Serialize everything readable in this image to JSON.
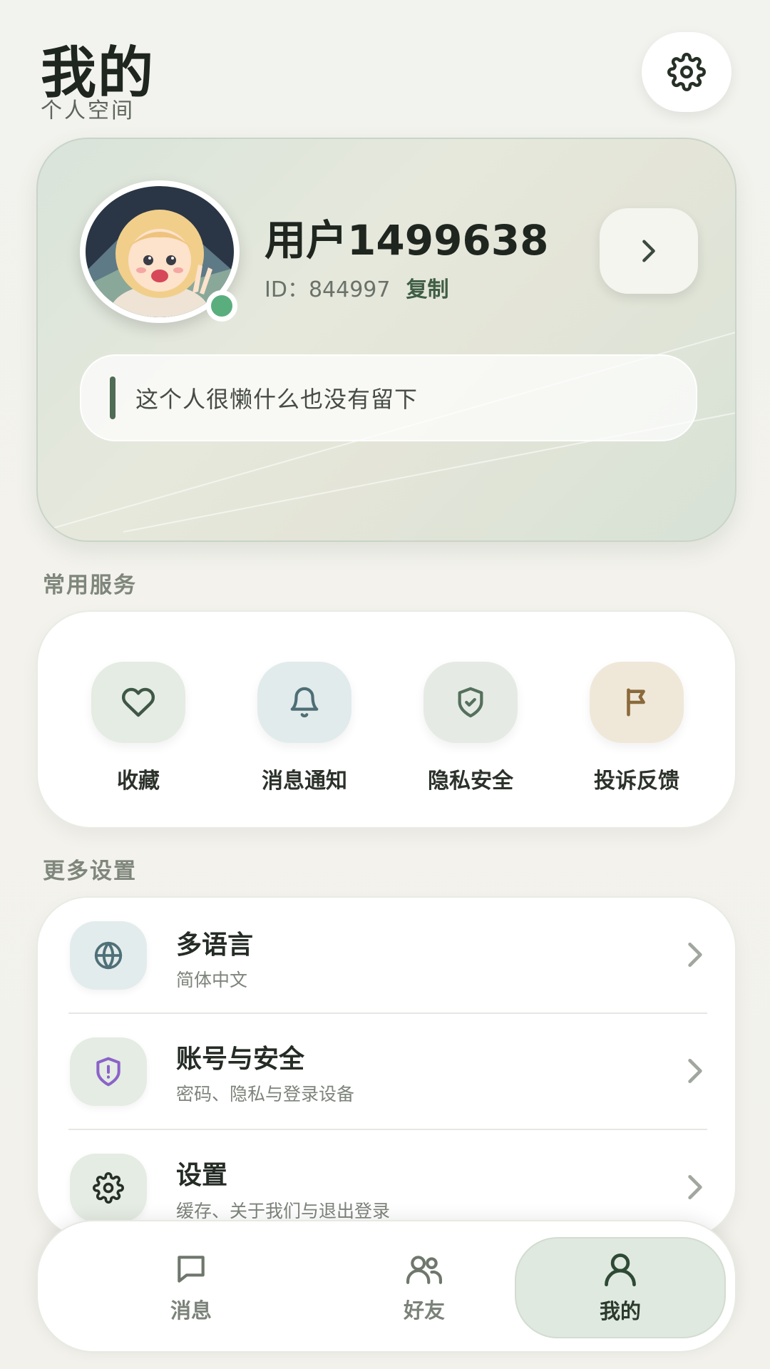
{
  "header": {
    "title": "我的",
    "subtitle": "个人空间",
    "settings_icon": "gear-icon"
  },
  "profile": {
    "username": "用户1499638",
    "id_label": "ID：844997",
    "copy_label": "复制",
    "bio": "这个人很懒什么也没有留下",
    "online_status_color": "#5aae7d"
  },
  "services": {
    "section_title": "常用服务",
    "items": [
      {
        "label": "收藏",
        "icon": "heart-icon",
        "bg": "#e5ece3"
      },
      {
        "label": "消息通知",
        "icon": "bell-icon",
        "bg": "#e1ebeb"
      },
      {
        "label": "隐私安全",
        "icon": "shield-check-icon",
        "bg": "#e5ebe4"
      },
      {
        "label": "投诉反馈",
        "icon": "flag-icon",
        "bg": "#efe8d9"
      }
    ]
  },
  "more_settings": {
    "section_title": "更多设置",
    "items": [
      {
        "title": "多语言",
        "subtitle": "简体中文",
        "icon": "globe-icon"
      },
      {
        "title": "账号与安全",
        "subtitle": "密码、隐私与登录设备",
        "icon": "shield-alert-icon"
      },
      {
        "title": "设置",
        "subtitle": "缓存、关于我们与退出登录",
        "icon": "gear-icon"
      }
    ]
  },
  "bottom_nav": {
    "items": [
      {
        "label": "消息",
        "icon": "chat-icon",
        "active": false
      },
      {
        "label": "好友",
        "icon": "friends-icon",
        "active": false
      },
      {
        "label": "我的",
        "icon": "user-icon",
        "active": true
      }
    ]
  },
  "colors": {
    "accent_green": "#3f5e44",
    "privacy_icon_purple": "#8a63c9",
    "flag_brown": "#8a6a3c"
  }
}
